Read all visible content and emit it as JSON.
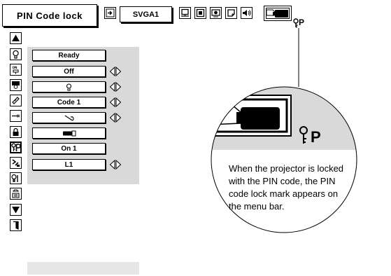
{
  "header": {
    "title": "PIN Code lock",
    "input_label": "SVGA1",
    "pin_mark": "P"
  },
  "menu": {
    "items": [
      {
        "value": "Ready",
        "arrows": false
      },
      {
        "value": "Off",
        "arrows": true
      },
      {
        "value": "",
        "arrows": true
      },
      {
        "value": "Code 1",
        "arrows": true
      },
      {
        "value": "",
        "arrows": true
      },
      {
        "value": "",
        "arrows": false
      },
      {
        "value": "On 1",
        "arrows": false
      },
      {
        "value": "L1",
        "arrows": true
      }
    ]
  },
  "callout": {
    "pin_mark": "P",
    "text": "When the projector is locked with the PIN code,  the PIN code lock mark appears  on the menu bar."
  }
}
